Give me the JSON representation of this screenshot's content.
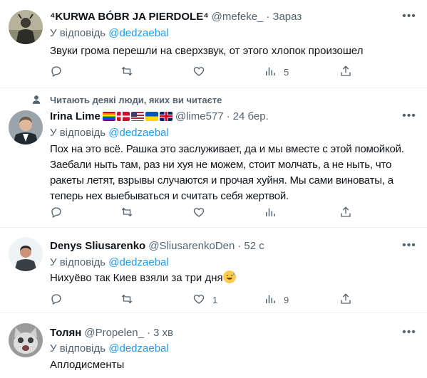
{
  "icons": {
    "reply": "reply-icon",
    "retweet": "retweet-icon",
    "like": "like-icon",
    "views": "analytics-icon",
    "share": "share-icon",
    "more": "more-icon",
    "social_context": "user-icon"
  },
  "colors": {
    "mention": "#1d9bf0",
    "secondary": "#536471",
    "text": "#0f1419",
    "divider": "#eff3f4"
  },
  "reply_prefix": "У відповідь",
  "tweets": [
    {
      "name": "⁴KURWA BÓBR JA PIERDOLE⁴",
      "handle": "@mefeke_",
      "dot": "·",
      "time": "Зараз",
      "reply_to": "@dedzaebal",
      "text": "Звуки грома перешли на сверхзвук, от этого хлопок произошел",
      "counts": {
        "reply": "",
        "retweet": "",
        "like": "",
        "views": "5"
      }
    },
    {
      "social_context": "Читають деякі люди, яких ви читаєте",
      "name": "Irina Lime",
      "flags": [
        "rainbow",
        "denmark",
        "usa",
        "ukraine",
        "uk"
      ],
      "handle": "@lime577",
      "dot": "·",
      "time": "24 бер.",
      "reply_to": "@dedzaebal",
      "text": "Пох на это всё. Рашка это заслуживает, да и мы вместе с этой помойкой. Заебали ныть там, раз ни хуя не можем, стоит молчать, а не ныть, что ракеты летят, взрывы случаются и прочая хуйня. Мы сами виноваты, а теперь нех выебываться и считать себя жертвой.",
      "counts": {
        "reply": "",
        "retweet": "",
        "like": "",
        "views": ""
      }
    },
    {
      "name": "Denys Sliusarenko",
      "handle": "@SliusarenkoDen",
      "dot": "·",
      "time": "52 с",
      "reply_to": "@dedzaebal",
      "text": "Нихуёво так Киев взяли за три дня",
      "emoji": "sweat-smile-emoji",
      "counts": {
        "reply": "",
        "retweet": "",
        "like": "1",
        "views": "9"
      }
    },
    {
      "name": "Толян",
      "handle": "@Propelen_",
      "dot": "·",
      "time": "3 хв",
      "reply_to": "@dedzaebal",
      "text": "Аплодисменты"
    }
  ]
}
